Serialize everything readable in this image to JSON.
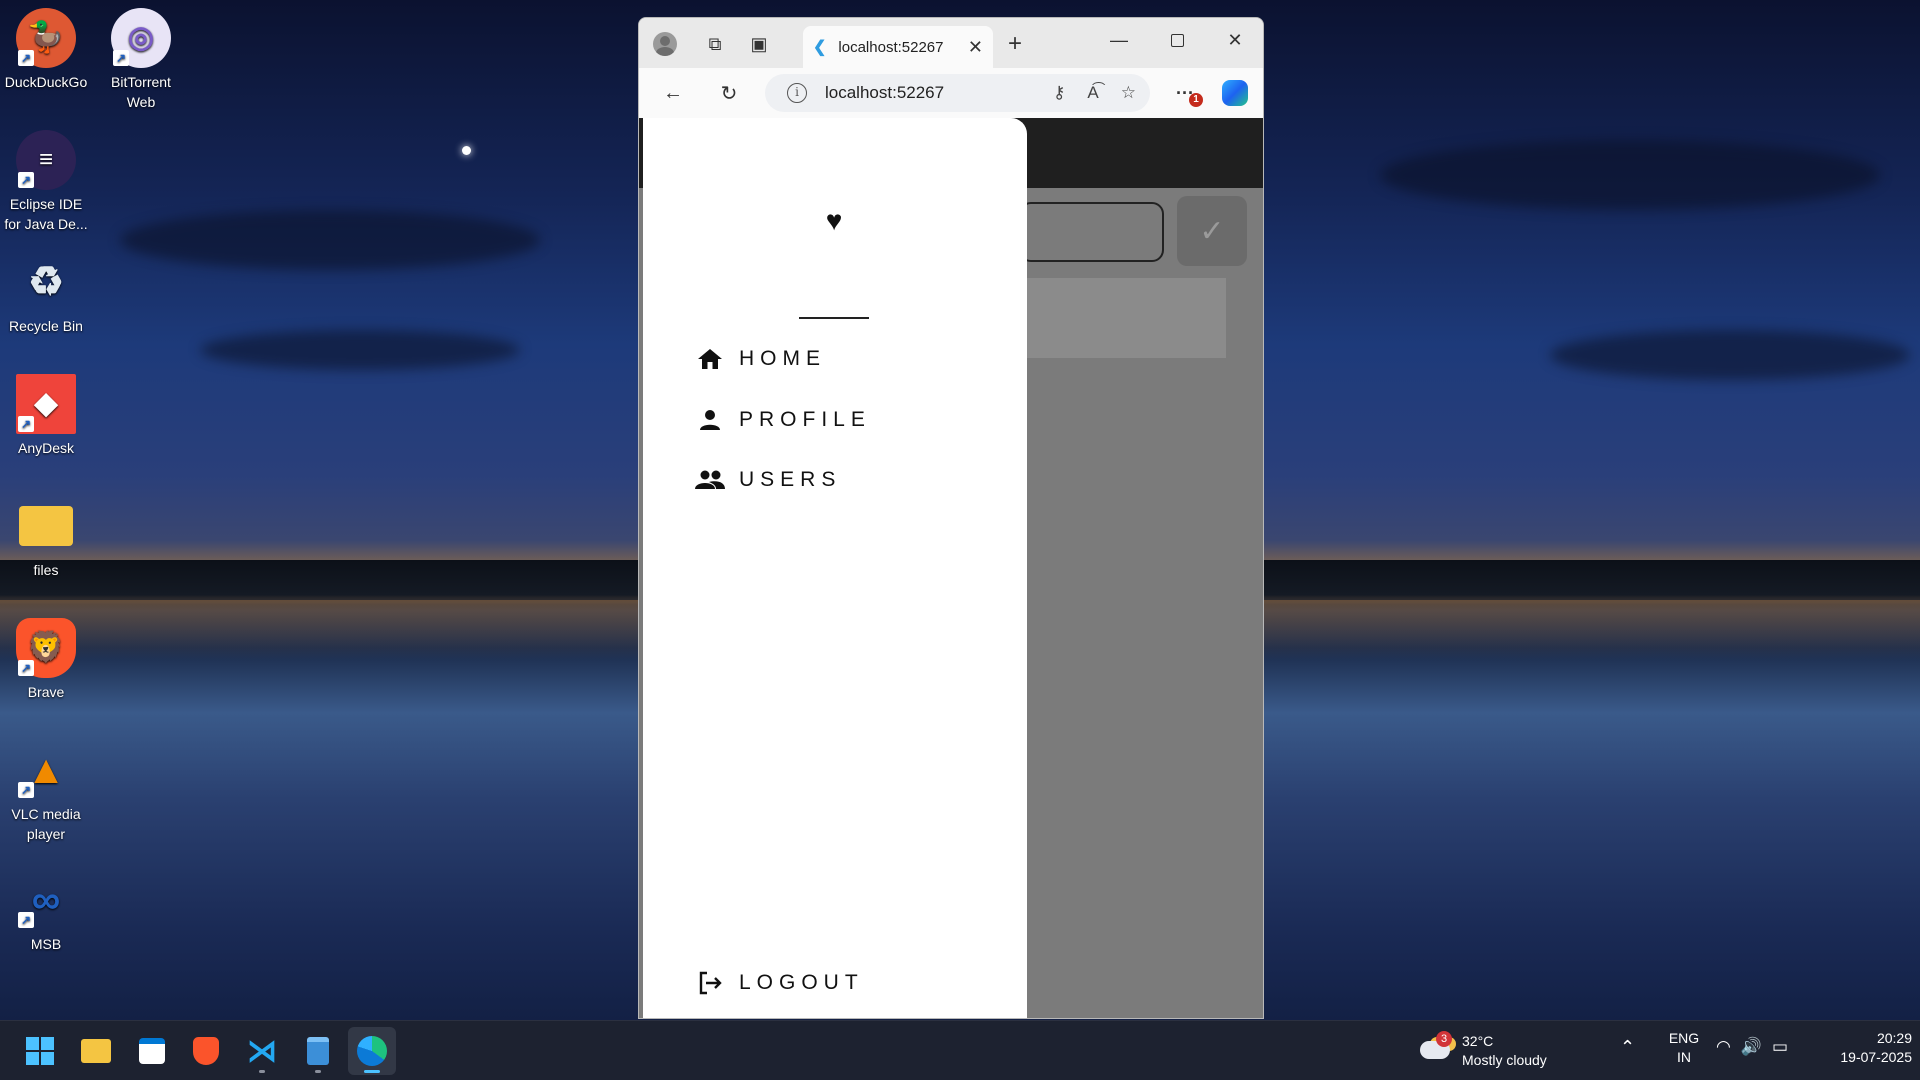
{
  "desktop": {
    "icons": [
      {
        "label": "DuckDuckGo"
      },
      {
        "label": "BitTorrent Web"
      },
      {
        "label": "Eclipse IDE for Java De..."
      },
      {
        "label": "Recycle Bin"
      },
      {
        "label": "AnyDesk"
      },
      {
        "label": "files"
      },
      {
        "label": "Brave"
      },
      {
        "label": "VLC media player"
      },
      {
        "label": "MSB"
      }
    ]
  },
  "browser": {
    "tab_title": "localhost:52267",
    "url": "localhost:52267",
    "notification_count": "1"
  },
  "app": {
    "drawer": {
      "items": [
        {
          "label": "HOME",
          "icon": "home-icon"
        },
        {
          "label": "PROFILE",
          "icon": "person-icon"
        },
        {
          "label": "USERS",
          "icon": "group-icon"
        }
      ],
      "logout_label": "LOGOUT"
    }
  },
  "taskbar": {
    "weather_badge": "3",
    "temperature": "32°C",
    "weather_desc": "Mostly cloudy",
    "lang_line1": "ENG",
    "lang_line2": "IN",
    "time": "20:29",
    "date": "19-07-2025"
  },
  "colors": {
    "accent_edge": "#0078d4",
    "brave": "#fb542b",
    "anydesk": "#ef443b",
    "taskbar": "#1d2230"
  }
}
